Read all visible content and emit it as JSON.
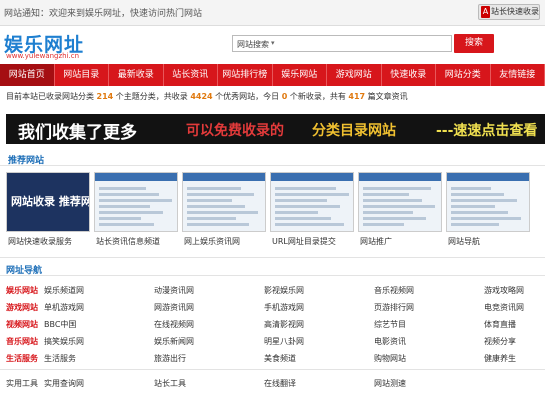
{
  "topbar": {
    "notice": "网站通知：欢迎来到娱乐网址，快速访问热门网站",
    "submit_label": "站长快速收录"
  },
  "header": {
    "logo": "娱乐网址",
    "logo_url": "www.yulewangzhi.cn",
    "search_select": "网站搜索",
    "search_button": "搜索"
  },
  "nav": [
    {
      "label": "网站首页",
      "active": true
    },
    {
      "label": "网站目录"
    },
    {
      "label": "最新收录"
    },
    {
      "label": "站长资讯"
    },
    {
      "label": "网站排行榜"
    },
    {
      "label": "娱乐网站"
    },
    {
      "label": "游戏网站"
    },
    {
      "label": "快速收录"
    },
    {
      "label": "网站分类"
    },
    {
      "label": "友情链接"
    }
  ],
  "stats": {
    "prefix": "目前本站已收录网站分类",
    "n1": "214",
    "t1": "个主题分类，共收录",
    "n2": "4424",
    "t2": "个优秀网站，今日",
    "n3": "0",
    "t3": "个新收录，共有",
    "n4": "417",
    "t4": "篇文章资讯"
  },
  "banner": {
    "t1": "我们收集了更多",
    "t2": "可以免费收录的",
    "t3": "分类目录网站",
    "t4": "---速速点击查看"
  },
  "recommended": {
    "title": "推荐网站",
    "items": [
      {
        "caption": "网站快速收录服务",
        "word": "网站收录 推荐网址"
      },
      {
        "caption": "站长资讯信息频道"
      },
      {
        "caption": "网上娱乐资讯网"
      },
      {
        "caption": "URL网址目录提交"
      },
      {
        "caption": "网站推广"
      },
      {
        "caption": "网站导航"
      }
    ]
  },
  "directory": {
    "title": "网址导航",
    "rows": [
      {
        "cat": "娱乐网站",
        "links": [
          "娱乐频道网",
          "动漫资讯网",
          "影视娱乐网",
          "音乐视频网",
          "游戏攻略网"
        ]
      },
      {
        "cat": "游戏网站",
        "links": [
          "单机游戏网",
          "网游资讯网",
          "手机游戏网",
          "页游排行网",
          "电竞资讯网"
        ]
      },
      {
        "cat": "视频网站",
        "links": [
          "BBC中国",
          "在线视频网",
          "高清影视网",
          "综艺节目",
          "体育直播"
        ]
      },
      {
        "cat": "音乐网站",
        "links": [
          "搞笑娱乐网",
          "娱乐新闻网",
          "明星八卦网",
          "电影资讯",
          "视频分享"
        ]
      },
      {
        "cat": "生活服务",
        "links": [
          "生活服务",
          "旅游出行",
          "美食频道",
          "购物网站",
          "健康养生"
        ]
      }
    ],
    "bottom": [
      "实用工具",
      "实用查询网",
      "站长工具",
      "在线翻译",
      "网站测速"
    ]
  }
}
